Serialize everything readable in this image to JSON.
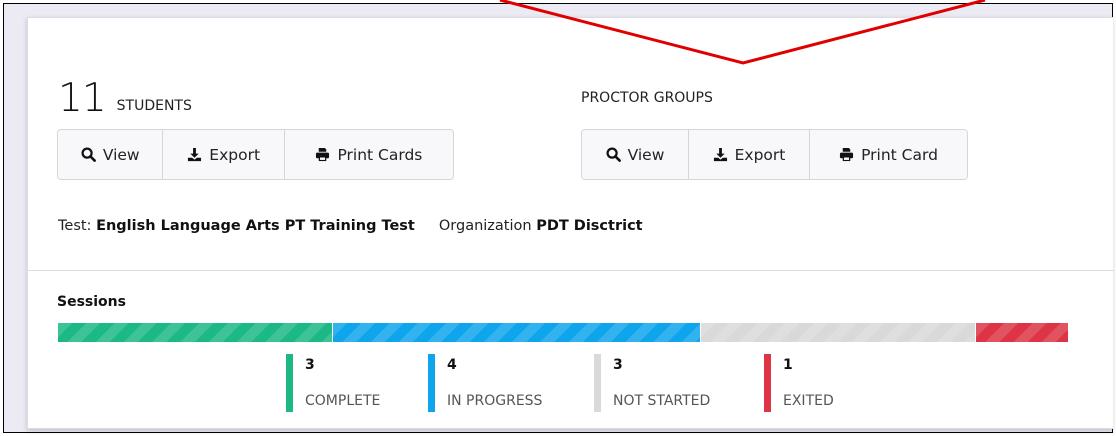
{
  "students": {
    "count": "11",
    "label": "STUDENTS",
    "buttons": {
      "view": "View",
      "export": "Export",
      "print": "Print Cards"
    }
  },
  "proctor": {
    "label": "PROCTOR GROUPS",
    "buttons": {
      "view": "View",
      "export": "Export",
      "print": "Print Card"
    }
  },
  "info": {
    "test_label": "Test:",
    "test_value": "English Language Arts PT Training Test",
    "org_label": "Organization",
    "org_value": "PDT Disctrict"
  },
  "sessions": {
    "title": "Sessions",
    "segments": [
      {
        "key": "complete",
        "value": 3,
        "label": "COMPLETE",
        "color": "#1cb886"
      },
      {
        "key": "in_progress",
        "value": 4,
        "label": "IN PROGRESS",
        "color": "#0ea5ec"
      },
      {
        "key": "not_started",
        "value": 3,
        "label": "NOT STARTED",
        "color": "#d9d9d9"
      },
      {
        "key": "exited",
        "value": 1,
        "label": "EXITED",
        "color": "#dd3545"
      }
    ]
  },
  "annotation": {
    "color": "#e00000"
  }
}
